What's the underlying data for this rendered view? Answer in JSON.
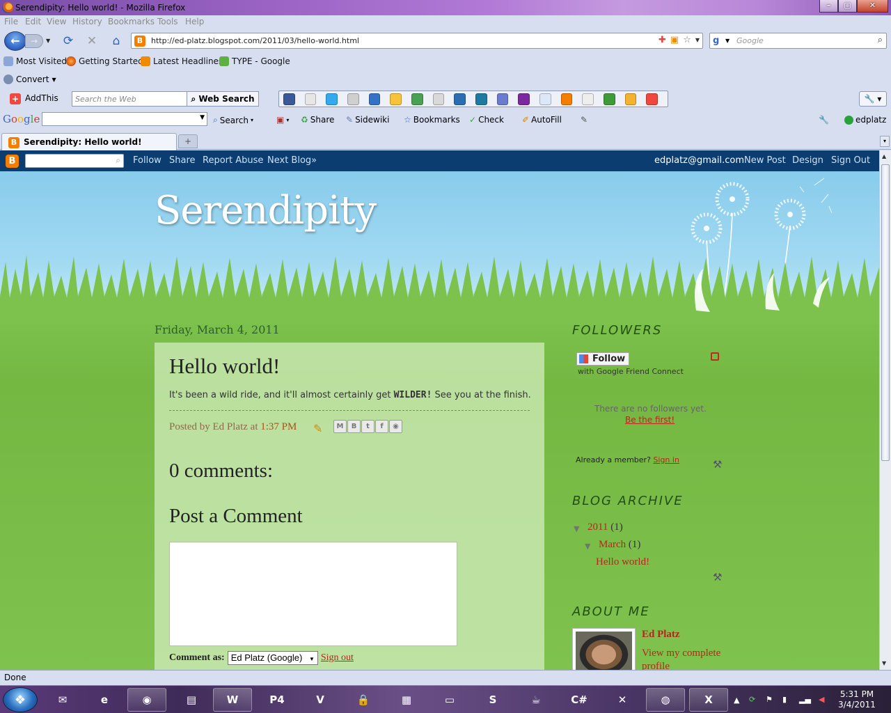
{
  "window": {
    "title": "Serendipity: Hello world! - Mozilla Firefox"
  },
  "menu": [
    "File",
    "Edit",
    "View",
    "History",
    "Bookmarks",
    "Tools",
    "Help"
  ],
  "nav": {
    "url": "http://ed-platz.blogspot.com/2011/03/hello-world.html",
    "search_placeholder": "Google"
  },
  "bookmarks": [
    "Most Visited",
    "Getting Started",
    "Latest Headlines",
    "TYPE - Google"
  ],
  "convert_label": "Convert",
  "addthis": {
    "label": "AddThis",
    "search_placeholder": "Search the Web",
    "button": "Web Search"
  },
  "googlebar": {
    "logo": "Google",
    "items": [
      "Search",
      "Share",
      "Sidewiki",
      "Bookmarks",
      "Check",
      "AutoFill"
    ],
    "account": "edplatz"
  },
  "tab": {
    "label": "Serendipity: Hello world!"
  },
  "blogger_bar": {
    "links": [
      "Follow",
      "Share",
      "Report Abuse",
      "Next Blog»"
    ],
    "email": "edplatz@gmail.com",
    "right_links": [
      "New Post",
      "Design",
      "Sign Out"
    ]
  },
  "blog": {
    "title": "Serendipity",
    "date": "Friday, March 4, 2011",
    "post": {
      "title": "Hello world!",
      "body_pre": "It's been a wild ride, and it'll almost certainly get",
      "body_emph": "WILDER!",
      "body_post": "See you at the finish.",
      "posted_by": "Posted by Ed Platz at",
      "time": "1:37 PM"
    },
    "comments_heading": "0 comments:",
    "post_comment_heading": "Post a Comment",
    "comment_as_label": "Comment as:",
    "comment_as_value": "Ed Platz (Google)",
    "sign_out": "Sign out"
  },
  "sidebar": {
    "followers_heading": "Followers",
    "follow_button": "Follow",
    "gfc_note": "with Google Friend Connect",
    "no_followers": "There are no followers yet.",
    "be_first": "Be the first!",
    "already_member": "Already a member?",
    "sign_in": "Sign in",
    "archive_heading": "Blog Archive",
    "archive_year": "2011",
    "archive_year_count": "(1)",
    "archive_month": "March",
    "archive_month_count": "(1)",
    "archive_post": "Hello world!",
    "about_heading": "About Me",
    "profile_name": "Ed Platz",
    "profile_link": "View my complete profile"
  },
  "status": "Done",
  "clock": {
    "time": "5:31 PM",
    "date": "3/4/2011"
  },
  "colors": {
    "link": "#b5271a",
    "blogger_bar": "#0b3d70",
    "sky": "#a3daf2",
    "grass": "#7cc24c"
  }
}
